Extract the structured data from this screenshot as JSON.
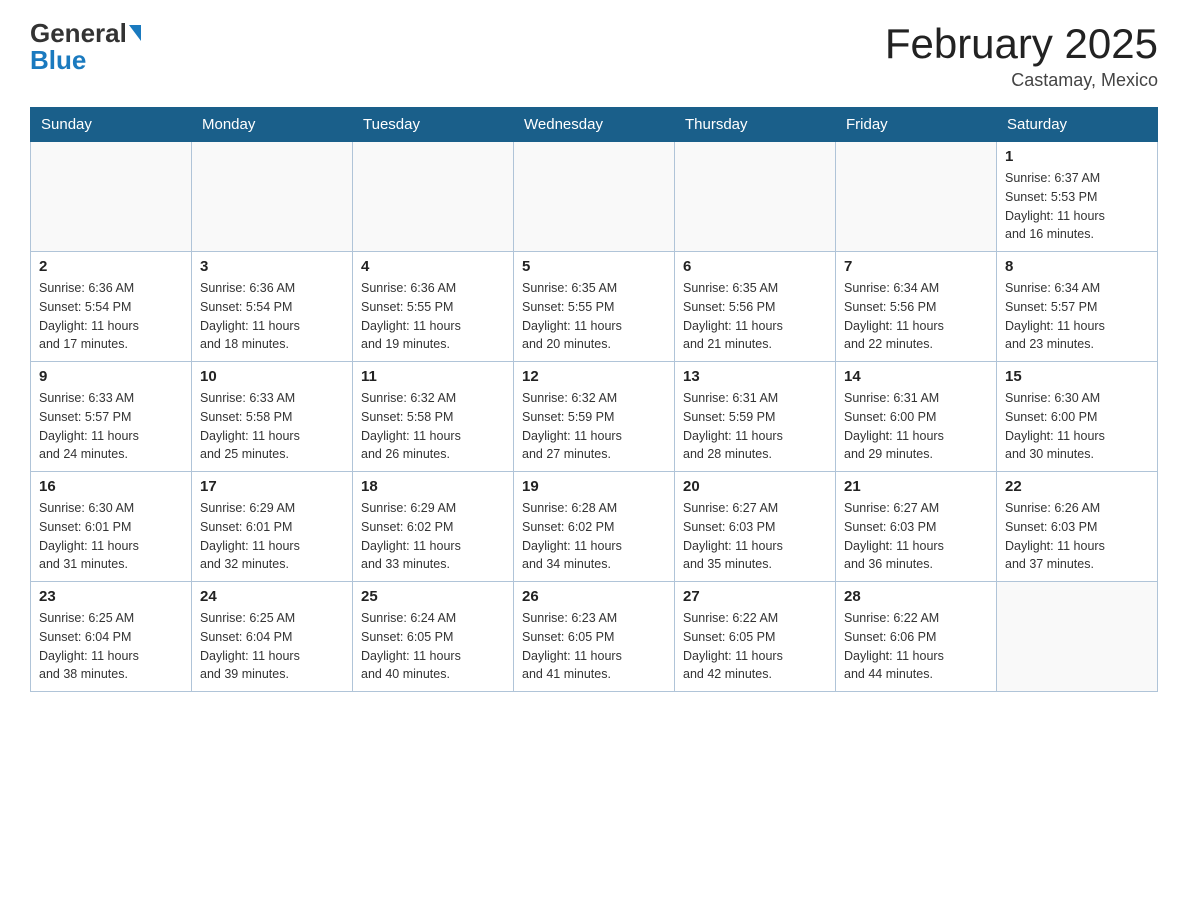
{
  "header": {
    "logo_general": "General",
    "logo_blue": "Blue",
    "month_title": "February 2025",
    "location": "Castamay, Mexico"
  },
  "days_of_week": [
    "Sunday",
    "Monday",
    "Tuesday",
    "Wednesday",
    "Thursday",
    "Friday",
    "Saturday"
  ],
  "weeks": [
    [
      {
        "day": "",
        "info": ""
      },
      {
        "day": "",
        "info": ""
      },
      {
        "day": "",
        "info": ""
      },
      {
        "day": "",
        "info": ""
      },
      {
        "day": "",
        "info": ""
      },
      {
        "day": "",
        "info": ""
      },
      {
        "day": "1",
        "info": "Sunrise: 6:37 AM\nSunset: 5:53 PM\nDaylight: 11 hours\nand 16 minutes."
      }
    ],
    [
      {
        "day": "2",
        "info": "Sunrise: 6:36 AM\nSunset: 5:54 PM\nDaylight: 11 hours\nand 17 minutes."
      },
      {
        "day": "3",
        "info": "Sunrise: 6:36 AM\nSunset: 5:54 PM\nDaylight: 11 hours\nand 18 minutes."
      },
      {
        "day": "4",
        "info": "Sunrise: 6:36 AM\nSunset: 5:55 PM\nDaylight: 11 hours\nand 19 minutes."
      },
      {
        "day": "5",
        "info": "Sunrise: 6:35 AM\nSunset: 5:55 PM\nDaylight: 11 hours\nand 20 minutes."
      },
      {
        "day": "6",
        "info": "Sunrise: 6:35 AM\nSunset: 5:56 PM\nDaylight: 11 hours\nand 21 minutes."
      },
      {
        "day": "7",
        "info": "Sunrise: 6:34 AM\nSunset: 5:56 PM\nDaylight: 11 hours\nand 22 minutes."
      },
      {
        "day": "8",
        "info": "Sunrise: 6:34 AM\nSunset: 5:57 PM\nDaylight: 11 hours\nand 23 minutes."
      }
    ],
    [
      {
        "day": "9",
        "info": "Sunrise: 6:33 AM\nSunset: 5:57 PM\nDaylight: 11 hours\nand 24 minutes."
      },
      {
        "day": "10",
        "info": "Sunrise: 6:33 AM\nSunset: 5:58 PM\nDaylight: 11 hours\nand 25 minutes."
      },
      {
        "day": "11",
        "info": "Sunrise: 6:32 AM\nSunset: 5:58 PM\nDaylight: 11 hours\nand 26 minutes."
      },
      {
        "day": "12",
        "info": "Sunrise: 6:32 AM\nSunset: 5:59 PM\nDaylight: 11 hours\nand 27 minutes."
      },
      {
        "day": "13",
        "info": "Sunrise: 6:31 AM\nSunset: 5:59 PM\nDaylight: 11 hours\nand 28 minutes."
      },
      {
        "day": "14",
        "info": "Sunrise: 6:31 AM\nSunset: 6:00 PM\nDaylight: 11 hours\nand 29 minutes."
      },
      {
        "day": "15",
        "info": "Sunrise: 6:30 AM\nSunset: 6:00 PM\nDaylight: 11 hours\nand 30 minutes."
      }
    ],
    [
      {
        "day": "16",
        "info": "Sunrise: 6:30 AM\nSunset: 6:01 PM\nDaylight: 11 hours\nand 31 minutes."
      },
      {
        "day": "17",
        "info": "Sunrise: 6:29 AM\nSunset: 6:01 PM\nDaylight: 11 hours\nand 32 minutes."
      },
      {
        "day": "18",
        "info": "Sunrise: 6:29 AM\nSunset: 6:02 PM\nDaylight: 11 hours\nand 33 minutes."
      },
      {
        "day": "19",
        "info": "Sunrise: 6:28 AM\nSunset: 6:02 PM\nDaylight: 11 hours\nand 34 minutes."
      },
      {
        "day": "20",
        "info": "Sunrise: 6:27 AM\nSunset: 6:03 PM\nDaylight: 11 hours\nand 35 minutes."
      },
      {
        "day": "21",
        "info": "Sunrise: 6:27 AM\nSunset: 6:03 PM\nDaylight: 11 hours\nand 36 minutes."
      },
      {
        "day": "22",
        "info": "Sunrise: 6:26 AM\nSunset: 6:03 PM\nDaylight: 11 hours\nand 37 minutes."
      }
    ],
    [
      {
        "day": "23",
        "info": "Sunrise: 6:25 AM\nSunset: 6:04 PM\nDaylight: 11 hours\nand 38 minutes."
      },
      {
        "day": "24",
        "info": "Sunrise: 6:25 AM\nSunset: 6:04 PM\nDaylight: 11 hours\nand 39 minutes."
      },
      {
        "day": "25",
        "info": "Sunrise: 6:24 AM\nSunset: 6:05 PM\nDaylight: 11 hours\nand 40 minutes."
      },
      {
        "day": "26",
        "info": "Sunrise: 6:23 AM\nSunset: 6:05 PM\nDaylight: 11 hours\nand 41 minutes."
      },
      {
        "day": "27",
        "info": "Sunrise: 6:22 AM\nSunset: 6:05 PM\nDaylight: 11 hours\nand 42 minutes."
      },
      {
        "day": "28",
        "info": "Sunrise: 6:22 AM\nSunset: 6:06 PM\nDaylight: 11 hours\nand 44 minutes."
      },
      {
        "day": "",
        "info": ""
      }
    ]
  ]
}
